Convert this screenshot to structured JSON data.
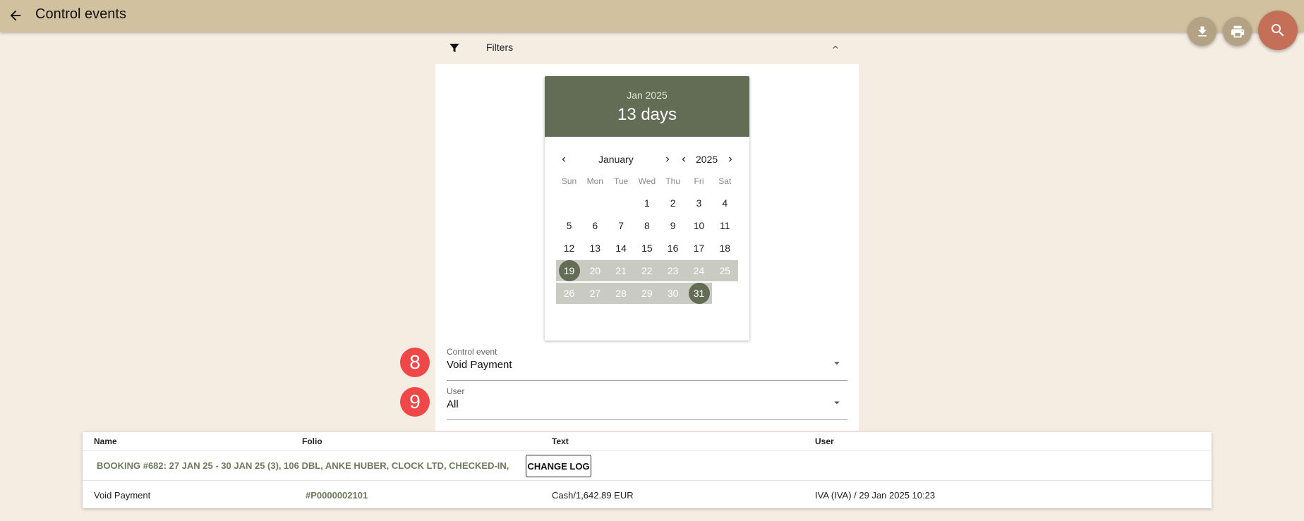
{
  "header": {
    "title": "Control events"
  },
  "icons": {
    "back": "arrow-left-icon",
    "download": "download-icon",
    "print": "print-icon",
    "search": "search-icon",
    "filter": "filter-icon"
  },
  "colors": {
    "header_bg": "#d1c19e",
    "accent": "#636d56",
    "badge": "#f04848",
    "search_fab": "#c56f58"
  },
  "filters": {
    "label": "Filters"
  },
  "calendar": {
    "month_year": "Jan 2025",
    "range_label": "13 days",
    "month": "January",
    "year": "2025",
    "weekdays": [
      "Sun",
      "Mon",
      "Tue",
      "Wed",
      "Thu",
      "Fri",
      "Sat"
    ],
    "weeks": [
      [
        "",
        "",
        "",
        "1",
        "2",
        "3",
        "4"
      ],
      [
        "5",
        "6",
        "7",
        "8",
        "9",
        "10",
        "11"
      ],
      [
        "12",
        "13",
        "14",
        "15",
        "16",
        "17",
        "18"
      ],
      [
        "19",
        "20",
        "21",
        "22",
        "23",
        "24",
        "25"
      ],
      [
        "26",
        "27",
        "28",
        "29",
        "30",
        "31",
        ""
      ]
    ],
    "range_start": 19,
    "range_end": 31
  },
  "control_event": {
    "badge": "8",
    "label": "Control event",
    "value": "Void Payment"
  },
  "user_filter": {
    "badge": "9",
    "label": "User",
    "value": "All"
  },
  "table": {
    "headers": {
      "name": "Name",
      "folio": "Folio",
      "text": "Text",
      "user": "User"
    },
    "group": {
      "text": "BOOKING #682: 27 JAN 25 - 30 JAN 25 (3), 106 DBL, ANKE HUBER, CLOCK LTD, CHECKED-IN,",
      "button": "CHANGE LOG"
    },
    "row": {
      "name": "Void Payment",
      "folio": "#P0000002101",
      "text": "Cash/1,642.89 EUR",
      "user": "IVA (IVA) / 29 Jan 2025 10:23"
    }
  }
}
